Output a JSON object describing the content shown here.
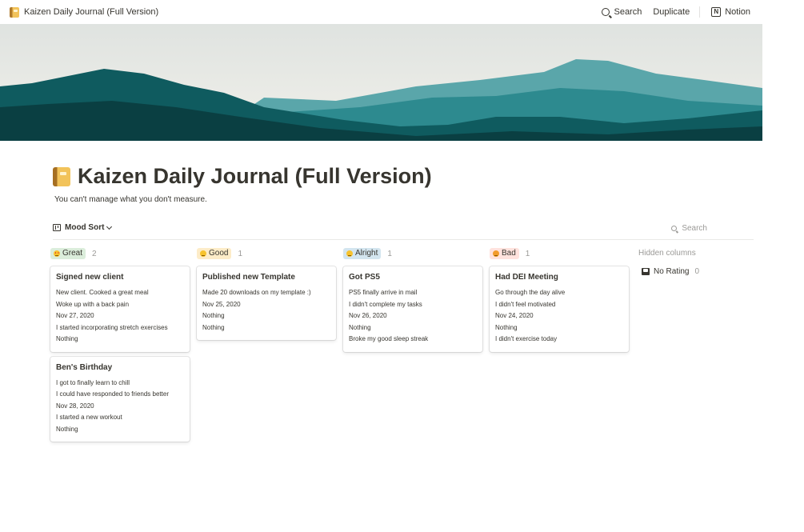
{
  "topbar": {
    "page_title": "Kaizen Daily Journal (Full Version)",
    "search_label": "Search",
    "duplicate_label": "Duplicate",
    "notion_label": "Notion"
  },
  "cover": {
    "sky_color": "#e8ecea",
    "mountain_colors": [
      "#5aa6aa",
      "#2d8a8f",
      "#0f5b5f",
      "#0a3f42"
    ]
  },
  "page": {
    "title": "Kaizen Daily Journal (Full Version)",
    "description": "You can't manage what you don't measure."
  },
  "view": {
    "name": "Mood Sort",
    "search_label": "Search"
  },
  "columns": [
    {
      "label": "Great",
      "count": "2",
      "tag_color": "#dbeddb",
      "cards": [
        {
          "title": "Signed new client",
          "props": [
            "New client. Cooked a great meal",
            "Woke up with a back pain",
            "Nov 27, 2020",
            "I started incorporating stretch exercises",
            "Nothing"
          ]
        },
        {
          "title": "Ben's Birthday",
          "props": [
            "I got to finally learn to chill",
            "I could have responded to friends better",
            "Nov 28, 2020",
            "I started a new workout",
            "Nothing"
          ]
        }
      ]
    },
    {
      "label": "Good",
      "count": "1",
      "tag_color": "#fdecc8",
      "cards": [
        {
          "title": "Published new Template",
          "props": [
            "Made 20 downloads on my template :)",
            "Nov 25, 2020",
            "Nothing",
            "Nothing"
          ]
        }
      ]
    },
    {
      "label": "Alright",
      "count": "1",
      "tag_color": "#d3e5ef",
      "cards": [
        {
          "title": "Got PS5",
          "props": [
            "PS5 finally arrive in mail",
            "I didn't complete my tasks",
            "Nov 26, 2020",
            "Nothing",
            "Broke my good sleep streak"
          ]
        }
      ]
    },
    {
      "label": "Bad",
      "count": "1",
      "tag_color": "#ffe2dd",
      "cards": [
        {
          "title": "Had DEI Meeting",
          "props": [
            "Go through the day alive",
            "I didn't feel motivated",
            "Nov 24, 2020",
            "Nothing",
            "I didn't exercise today"
          ]
        }
      ]
    }
  ],
  "hidden_columns": {
    "label": "Hidden columns",
    "items": [
      {
        "label": "No Rating",
        "count": "0"
      }
    ]
  }
}
